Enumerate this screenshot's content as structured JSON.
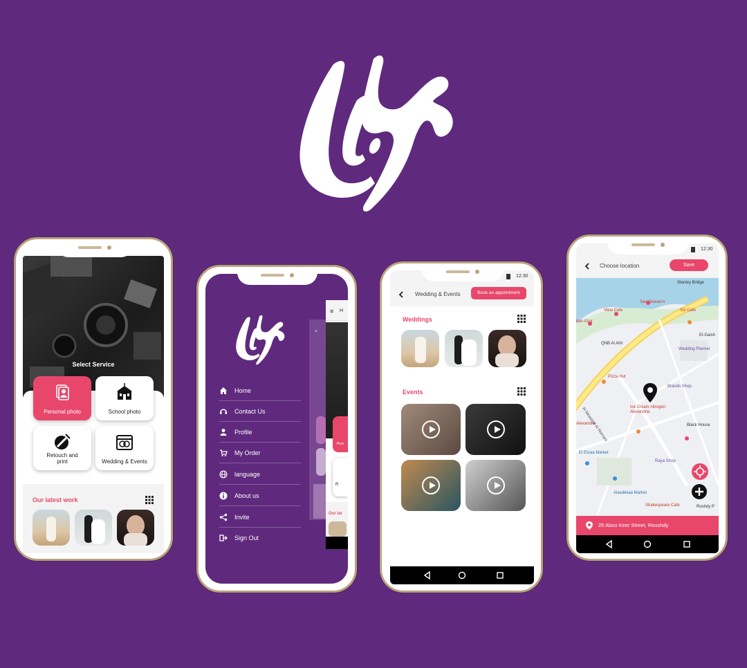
{
  "brand": {
    "logo_icon": "gazal-arabic-logo-icon"
  },
  "phone1": {
    "select_service": "Select Service",
    "services": [
      {
        "label": "Personal photo",
        "icon": "portrait-icon"
      },
      {
        "label": "School photo",
        "icon": "school-icon"
      },
      {
        "label": "Retouch and print",
        "icon": "retouch-icon"
      },
      {
        "label": "Wedding & Events",
        "icon": "rings-icon"
      }
    ],
    "latest_work": "Our latest work"
  },
  "phone2": {
    "menu": [
      {
        "label": "Home",
        "icon": "home-icon"
      },
      {
        "label": "Contact Us",
        "icon": "headset-icon"
      },
      {
        "label": "Profile",
        "icon": "user-icon"
      },
      {
        "label": "My Order",
        "icon": "cart-icon"
      },
      {
        "label": "language",
        "icon": "globe-icon"
      },
      {
        "label": "About us",
        "icon": "info-icon"
      },
      {
        "label": "Invite",
        "icon": "share-icon"
      },
      {
        "label": "Sign Out",
        "icon": "signout-icon"
      }
    ],
    "peek_h": "H",
    "peek_ourlat": "Our lat",
    "peek_pers": "Pers",
    "peek_r": "R"
  },
  "phone3": {
    "time": "12:30",
    "title": "Wedding & Events",
    "book_button": "Book an appointment",
    "weddings": "Weddings",
    "events": "Events"
  },
  "phone4": {
    "time": "12:30",
    "title": "Choose location",
    "save_button": "Save",
    "address": "25 Abou Keer Street, Roushdy",
    "map_labels": [
      "Stanley Bridge",
      "View Cafe",
      "Sol Cafe",
      "San Giovanni",
      "Wedding Planner",
      "QNB Al Ahli",
      "El-Gaish",
      "Pizza Hut",
      "Brands Shop",
      "Ice Cream nitrogen Alexandria",
      "Black House",
      "Alexandria",
      "El Esraa Market",
      "Raya Shop",
      "Alasdekaa Market",
      "Shakespeare Cafe",
      "Roshdy P",
      "Al Moaskar Al Romani",
      "Abu Qir",
      "ban Azur"
    ]
  },
  "colors": {
    "bg": "#5f2a7d",
    "accent": "#e8476b",
    "frame": "#b9a27c"
  }
}
